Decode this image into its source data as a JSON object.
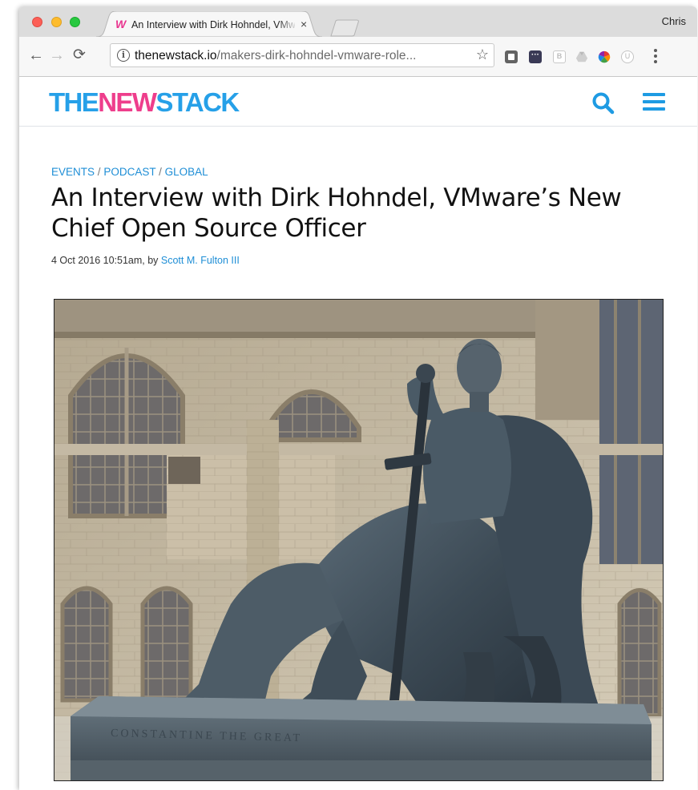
{
  "browser": {
    "tab": {
      "favicon": "W",
      "title": "An Interview with Dirk Hohndel, VMware’s New Chief Open Source Officer",
      "close_label": "×"
    },
    "profile_name": "Chris",
    "toolbar": {
      "url_domain": "thenewstack.io",
      "url_path": "/makers-dirk-hohndel-vmware-role...",
      "extensions": [
        "extension-square-icon",
        "extension-dots-icon",
        "extension-b-icon",
        "google-drive-icon",
        "color-wheel-icon",
        "extension-circle-icon"
      ]
    }
  },
  "site": {
    "logo": {
      "part1": "THE",
      "part2": "NEW",
      "part3": "STACK"
    },
    "brand_colors": {
      "blue": "#26a0e8",
      "pink": "#ee3e8c"
    }
  },
  "article": {
    "categories": [
      "EVENTS",
      "PODCAST",
      "GLOBAL"
    ],
    "category_separator": "/",
    "headline": "An Interview with Dirk Hohndel, VMware’s New Chief Open Source Officer",
    "byline_prefix": "4 Oct 2016 10:51am, by ",
    "author": "Scott M. Fulton III",
    "hero_image": {
      "subject": "bronze-seated-statue-photo",
      "plinth_text": "CONSTANTINE THE GREAT"
    }
  }
}
